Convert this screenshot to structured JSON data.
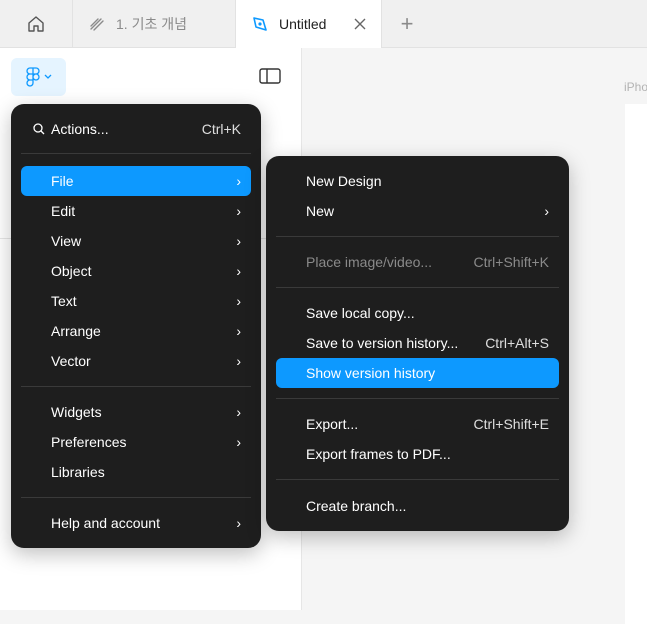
{
  "tabs": {
    "home_icon": "home-icon",
    "doc1": {
      "label": "1. 기초 개념",
      "icon": "draft-icon"
    },
    "active": {
      "label": "Untitled",
      "icon": "figjam-pen-icon"
    },
    "add_label": "+"
  },
  "canvas": {
    "frame_label": "iPho"
  },
  "main_menu": {
    "search": {
      "label": "Actions...",
      "shortcut": "Ctrl+K"
    },
    "items": [
      {
        "label": "File",
        "arrow": "›"
      },
      {
        "label": "Edit",
        "arrow": "›"
      },
      {
        "label": "View",
        "arrow": "›"
      },
      {
        "label": "Object",
        "arrow": "›"
      },
      {
        "label": "Text",
        "arrow": "›"
      },
      {
        "label": "Arrange",
        "arrow": "›"
      },
      {
        "label": "Vector",
        "arrow": "›"
      },
      {
        "label": "Widgets",
        "arrow": "›"
      },
      {
        "label": "Preferences",
        "arrow": "›"
      },
      {
        "label": "Libraries"
      },
      {
        "label": "Help and account",
        "arrow": "›"
      }
    ]
  },
  "file_menu": {
    "items": [
      {
        "label": "New Design"
      },
      {
        "label": "New",
        "arrow": "›"
      },
      {
        "label": "Place image/video...",
        "shortcut": "Ctrl+Shift+K"
      },
      {
        "label": "Save local copy..."
      },
      {
        "label": "Save to version history...",
        "shortcut": "Ctrl+Alt+S"
      },
      {
        "label": "Show version history"
      },
      {
        "label": "Export...",
        "shortcut": "Ctrl+Shift+E"
      },
      {
        "label": "Export frames to PDF..."
      },
      {
        "label": "Create branch..."
      }
    ]
  },
  "colors": {
    "accent": "#0d99ff",
    "menu_bg": "#1e1e1e"
  }
}
